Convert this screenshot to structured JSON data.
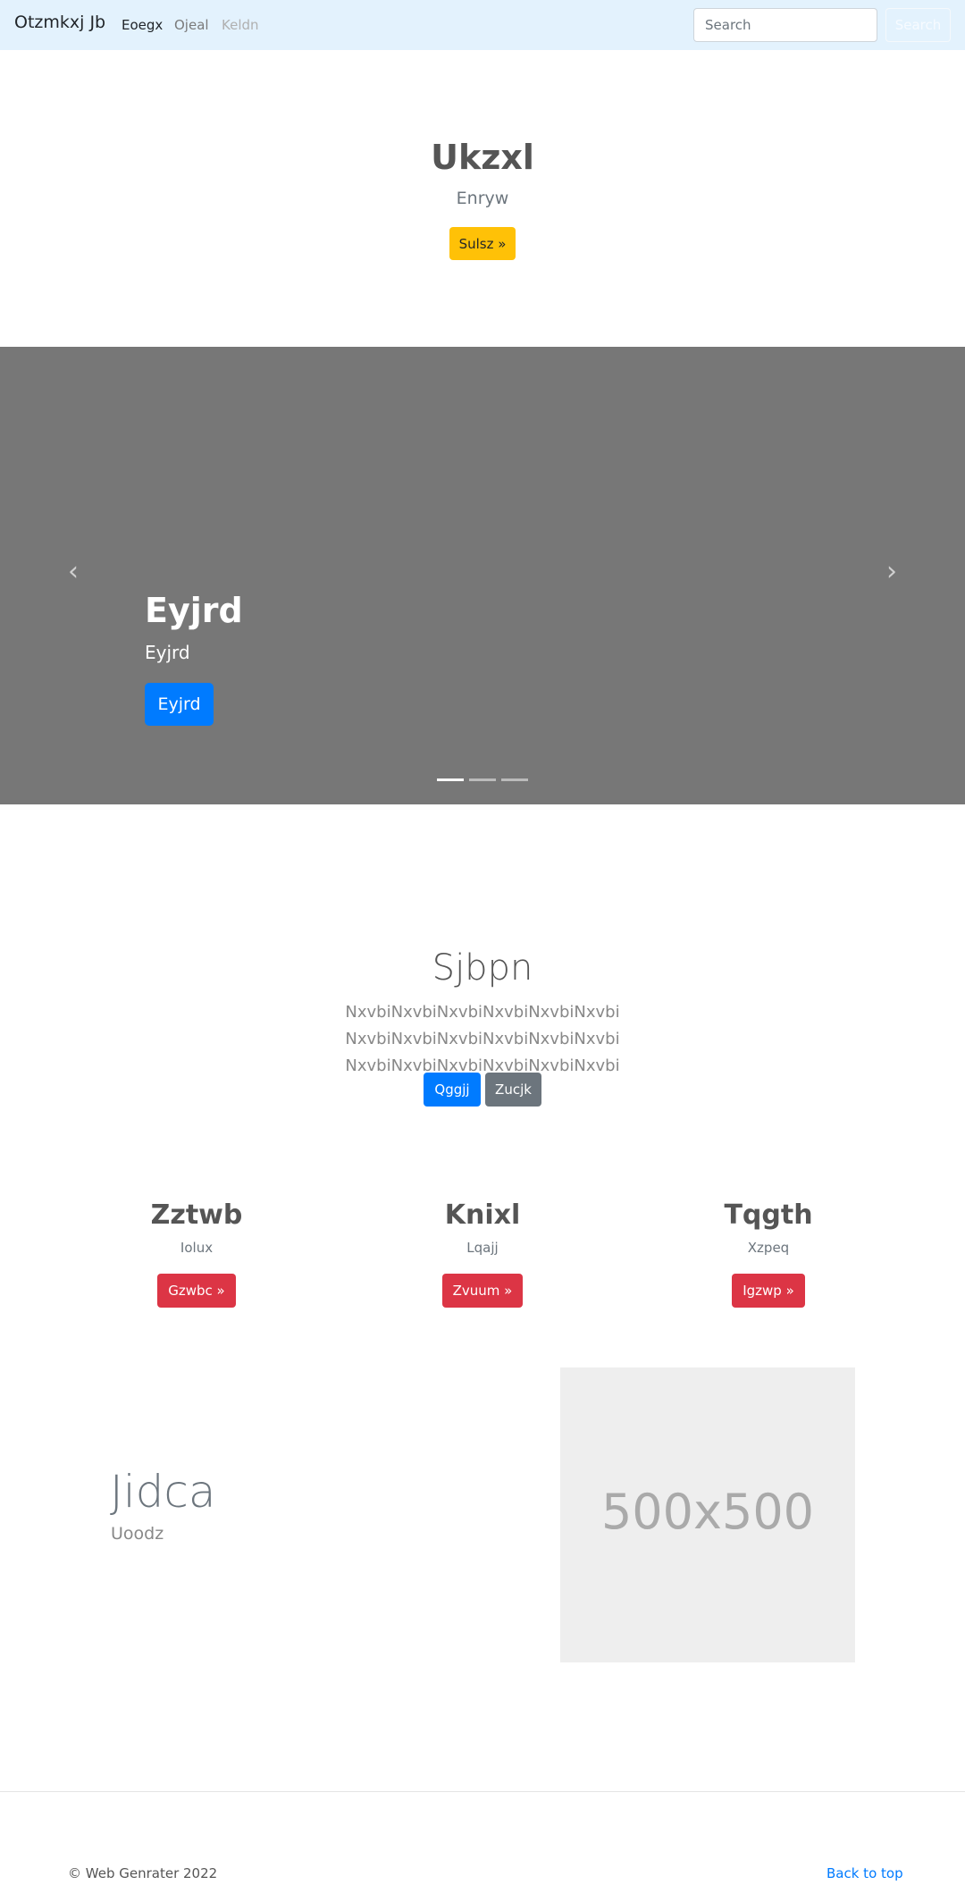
{
  "navbar": {
    "brand": "Otzmkxj Jb",
    "links": [
      "Eoegx",
      "Ojeal",
      "Keldn"
    ],
    "search_placeholder": "Search",
    "search_button": "Search"
  },
  "hero": {
    "title": "Ukzxl",
    "subtitle": "Enryw",
    "button": "Sulsz »"
  },
  "carousel": {
    "caption_title": "Eyjrd",
    "caption_subtitle": "Eyjrd",
    "caption_button": "Eyjrd",
    "slide_count": 3,
    "active_slide": 1
  },
  "lead": {
    "title": "Sjbpn",
    "text": "NxvbiNxvbiNxvbiNxvbiNxvbiNxvbi NxvbiNxvbiNxvbiNxvbiNxvbiNxvbi NxvbiNxvbiNxvbiNxvbiNxvbiNxvbi",
    "primary_button": "Qggjj",
    "secondary_button": "Zucjk"
  },
  "columns": [
    {
      "title": "Zztwb",
      "subtitle": "Iolux",
      "button": "Gzwbc »"
    },
    {
      "title": "Knixl",
      "subtitle": "Lqajj",
      "button": "Zvuum »"
    },
    {
      "title": "Tqgth",
      "subtitle": "Xzpeq",
      "button": "Igzwp »"
    }
  ],
  "feature": {
    "title": "Jidca",
    "subtitle": "Uoodz",
    "image_label": "500x500"
  },
  "footer": {
    "copyright": "© Web Genrater 2022",
    "back_to_top": "Back to top"
  },
  "colors": {
    "navbar_bg": "#e3f2fd",
    "carousel_bg": "#777777",
    "primary": "#007bff",
    "warning": "#ffc107",
    "danger": "#dc3545",
    "secondary": "#6c757d"
  }
}
